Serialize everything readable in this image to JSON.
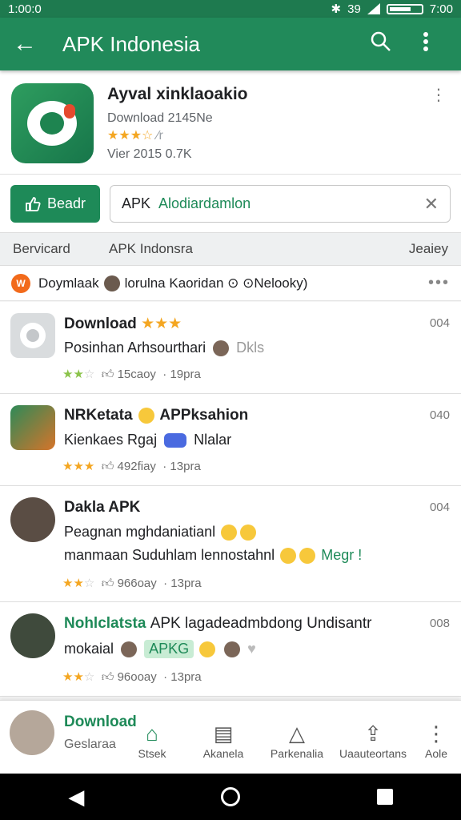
{
  "status_bar": {
    "left": "1:00:0",
    "signal_text": "39",
    "time": "7:00"
  },
  "app_bar": {
    "title": "APK Indonesia",
    "back_icon": "arrow-left-icon",
    "search_icon": "search-icon",
    "more_icon": "more-vert-icon"
  },
  "app_card": {
    "name": "Ayval xinklaoakio",
    "downloads": "Download  2145Ne",
    "stars": "★★★☆",
    "stars_suffix": "⁄r",
    "meta": "Vier 2015   0.7K"
  },
  "search": {
    "button_label": "Beadr",
    "prefix": "APK",
    "value": "Alodiardamlon"
  },
  "tabs": {
    "left": "Bervicard",
    "middle": "APK Indonsra",
    "right": "Jeaiey"
  },
  "notice": {
    "badge": "W",
    "text_a": "Doymlaak",
    "text_b": "lorulna Kaoridan ⊙ ⊙Nelooky)"
  },
  "items": [
    {
      "title": "Download",
      "title_emoji": "★★★",
      "line1": "Posinhan Arhsourthari",
      "line1_tail": "Dkls",
      "stars": "★★",
      "stars_off": "☆",
      "likes": "15caoy",
      "time": "19pra",
      "code": "004"
    },
    {
      "title": "NRKetata",
      "title_tail": "APPksahion",
      "line1": "Kienkaes Rgaj",
      "line1_tail": "Nlalar",
      "stars": "★★★",
      "stars_off": "",
      "likes": "492fiay",
      "time": "13pra",
      "code": "040"
    },
    {
      "title": "Dakla APK",
      "line1": "Peagnan mghdaniatianl",
      "line2": "manmaan Suduhlam lennostahnl",
      "line2_tail": "Megr !",
      "stars": "★★",
      "stars_off": "☆",
      "likes": "966oay",
      "time": "13pra",
      "code": "004"
    },
    {
      "title": "Nohlclatsta",
      "title_tail": "APK lagadeadmbdong Undisantr",
      "line1": "mokaial",
      "line1_pill": "APKG",
      "stars": "★★",
      "stars_off": "☆",
      "likes": "96ooay",
      "time": "13pra",
      "code": "008"
    }
  ],
  "bottom_nav": {
    "peek_title": "Download",
    "peek_sub": "Geslaraa",
    "items": [
      {
        "label": "Stsek",
        "icon": "home-icon"
      },
      {
        "label": "Akanela",
        "icon": "document-icon"
      },
      {
        "label": "Parkenalia",
        "icon": "notifications-icon"
      },
      {
        "label": "Uaauteortans",
        "icon": "upload-icon"
      },
      {
        "label": "Aole",
        "icon": "more-vert-icon"
      }
    ]
  }
}
